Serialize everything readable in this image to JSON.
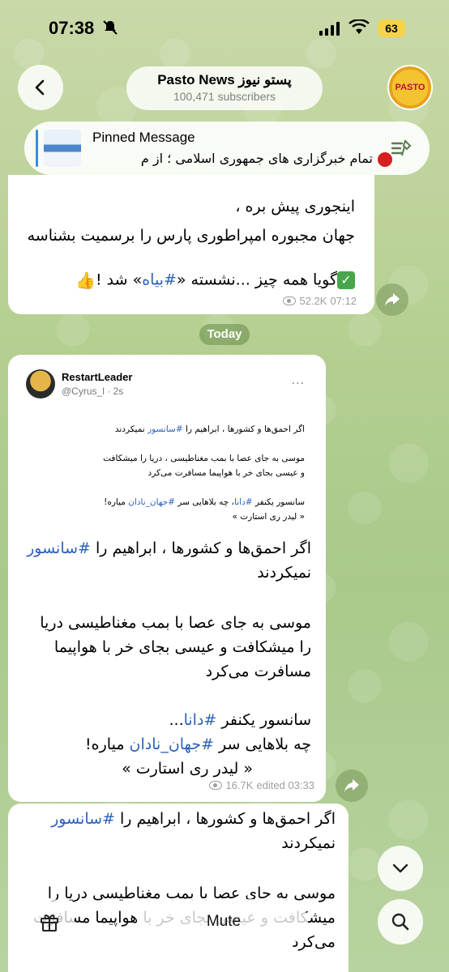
{
  "status_bar": {
    "time": "07:38",
    "battery": "63",
    "icons": [
      "bell-slash-icon",
      "signal-icon",
      "wifi-icon",
      "battery-icon"
    ]
  },
  "header": {
    "channel_title": "Pasto News پستو نیوز",
    "subscribers": "100,471 subscribers",
    "avatar_text": "PASTO",
    "back_icon": "chevron-left-icon"
  },
  "pinned": {
    "label": "Pinned Message",
    "text": "تمام خبرگزاری های جمهوری اسلامی ؛ از م",
    "icon": "pinned-list-icon"
  },
  "messages": [
    {
      "lines": [
        "اینجوری پیش بره ،",
        "جهان مجبوره امپراطوری پارس را برسمیت بشناسه"
      ],
      "last_line_prefix": "گویا همه چیز ...نشسته «",
      "last_line_tag": "#بیاه",
      "last_line_suffix": "» شد !",
      "views": "52.2K",
      "time": "07:12"
    },
    {
      "tweet": {
        "name": "RestartLeader",
        "handle": "@Cyrus_l",
        "age": "2s",
        "more": "...",
        "l1_prefix": "اگر احمق‌ها و کشورها ، ابراهیم را ",
        "l1_tag": "#سانسور",
        "l1_suffix": " نمیکردند",
        "l2": "موسی به جای عصا با بمب مغناطیسی ، دریا را میشکافت",
        "l3": "و عیسی بجای خر با هواپیما مسافرت می‌کرد",
        "l4_prefix": "سانسور یکنفر ",
        "l4_tag1": "#دانا",
        "l4_mid": "، چه بلاهایی سر ",
        "l4_tag2": "#جهان_نادان",
        "l4_suffix": " میاره!",
        "l5": "« لیدر ری استارت »"
      },
      "body": {
        "p1_prefix": "اگر احمق‌ها و کشورها ، ابراهیم را ",
        "p1_tag": "#سانسور",
        "p1_line2": "نمیکردند",
        "p2_line1": "موسی به جای عصا با بمب مغناطیسی دریا",
        "p2_line2": "را میشکافت و عیسی بجای خر با هواپیما",
        "p2_line3": "مسافرت می‌کرد",
        "p3_prefix": "سانسور یکنفر ",
        "p3_tag": "#دانا",
        "p3_suffix": "...",
        "p4_prefix": "چه بلاهایی سر ",
        "p4_tag": "#جهان_نادان",
        "p4_suffix": " میاره!",
        "p5": "« لیدر ری استارت »"
      },
      "views": "16.7K",
      "edited_time": "edited 03:33"
    },
    {
      "p1_prefix": "اگر احمق‌ها و کشورها ، ابراهیم را ",
      "p1_tag": "#سانسور",
      "p1_line2": "نمیکردند",
      "p2_line1": "موسی به جای عصا با بمب مغناطیسی دریا را",
      "p2_line2": "میشکافت و عیسی بجای خر با هواپیما مسافرت",
      "p2_line3": "می‌کرد"
    }
  ],
  "date_separator": "Today",
  "bottom": {
    "mute_label": "Mute",
    "gift_icon": "gift-icon",
    "search_icon": "search-icon",
    "scroll_icon": "chevron-down-icon"
  },
  "colors": {
    "hashtag": "#2c62b8",
    "link_bar": "#3a8fd6",
    "battery": "#f4d34a"
  }
}
